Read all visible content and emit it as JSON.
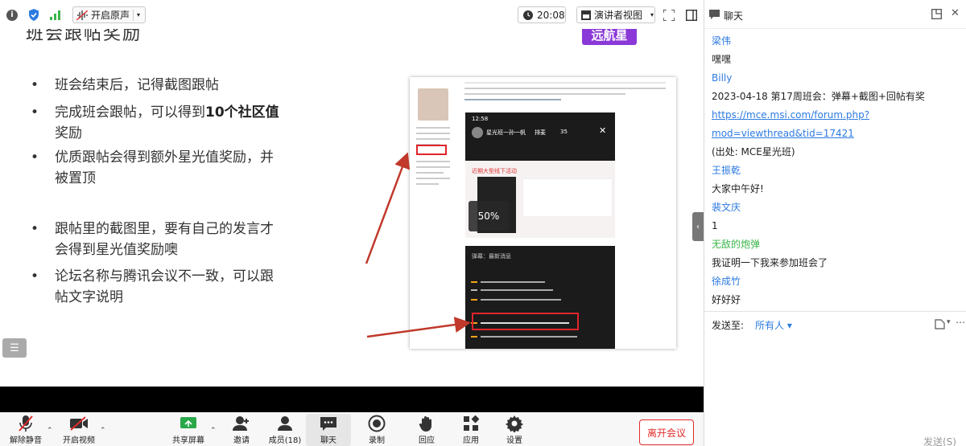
{
  "topbar": {
    "sound_label": "开启原声",
    "time": "20:08",
    "view_label": "演讲者视图"
  },
  "slide": {
    "title": "班会跟帖奖励",
    "logo_text": "远航星",
    "bullets": [
      {
        "line1": "班会结束后，记得截图跟帖",
        "line2": ""
      },
      {
        "line1_a": "完成班会跟帖，可以得到",
        "line1_b": "10个社区值",
        "line2": "奖励"
      },
      {
        "line1": "优质跟帖会得到额外星光值奖励，并",
        "line2": "被置顶"
      },
      {
        "line1": "跟帖里的截图里，要有自己的发言才",
        "line2": "会得到星光值奖励噢"
      },
      {
        "line1": "论坛名称与腾讯会议不一致，可以跟",
        "line2": "帖文字说明"
      }
    ],
    "thumb_time": "12:58",
    "thumb_room": "星光班一孙一帆",
    "thumb_rank": "排麦",
    "thumb_count": "35",
    "thumb_section": "近期大型线下活动",
    "thumb_chat_title": "弹幕：最新消息",
    "load_percent": "50%"
  },
  "toolbar": {
    "mute": "解除静音",
    "video": "开启视频",
    "share": "共享屏幕",
    "invite": "邀请",
    "members": "成员(18)",
    "chat": "聊天",
    "record": "录制",
    "react": "回应",
    "apps": "应用",
    "settings": "设置",
    "leave": "离开会议"
  },
  "chat": {
    "title": "聊天",
    "messages": [
      {
        "name": "梁伟",
        "lines": [
          "嘿嘿"
        ]
      },
      {
        "name": "Billy",
        "lines": [
          "2023-04-18 第17周班会：弹幕+截图+回帖有奖"
        ],
        "link": [
          "https://mce.msi.com/forum.php?",
          "mod=viewthread&tid=17421"
        ],
        "after": "(出处: MCE星光班)"
      },
      {
        "name": "王振乾",
        "lines": [
          "大家中午好!"
        ]
      },
      {
        "name": "裴文庆",
        "lines": [
          "1"
        ]
      },
      {
        "name": "无敌的炮弹",
        "lines": [
          "我证明一下我来参加班会了"
        ]
      },
      {
        "name": "徐成竹",
        "lines": [
          "好好好"
        ]
      }
    ],
    "send_to_label": "发送至:",
    "send_target": "所有人",
    "send_button": "发送(S)"
  },
  "colors": {
    "accent_blue": "#2d7be1",
    "name_green": "#39b54a",
    "leave_red": "#e02b2b",
    "annotation_red": "#c0392b"
  }
}
